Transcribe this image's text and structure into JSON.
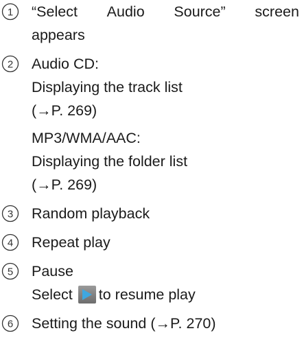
{
  "items": [
    {
      "number": "1",
      "lines": [
        "“Select Audio Source” screen",
        "appears"
      ]
    },
    {
      "number": "2",
      "lines": [
        "Audio CD:",
        "Displaying the track list",
        "(→P. 269)",
        "MP3/WMA/AAC:",
        "Displaying the folder list",
        "(→P. 269)"
      ]
    },
    {
      "number": "3",
      "lines": [
        "Random playback"
      ]
    },
    {
      "number": "4",
      "lines": [
        "Repeat play"
      ]
    },
    {
      "number": "5",
      "lines": [
        "Pause"
      ],
      "resume": {
        "before": "Select",
        "icon": "play-icon",
        "after": "to resume play"
      }
    },
    {
      "number": "6",
      "lines": [
        "Setting the sound (→P. 270)"
      ]
    }
  ],
  "colors": {
    "text": "#1a1a1a",
    "circle": "#333333",
    "play_button": "#7a7a7a",
    "play_arrow": "#3fa7e0"
  }
}
